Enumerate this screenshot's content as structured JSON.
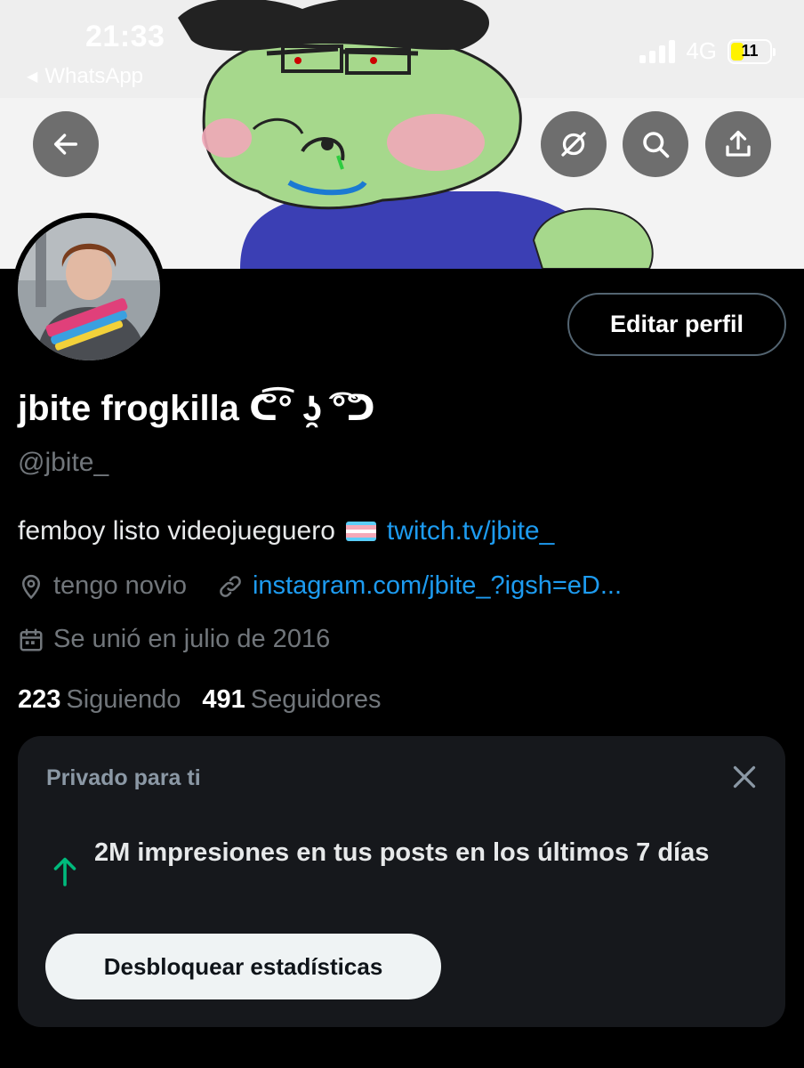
{
  "status_bar": {
    "time": "21:33",
    "back_app": "WhatsApp",
    "network": "4G",
    "battery": "11"
  },
  "header_buttons": {
    "back": "back-arrow-icon",
    "hide": "eye-slash-icon",
    "search": "search-icon",
    "share": "share-icon"
  },
  "profile": {
    "edit_button": "Editar perfil",
    "display_name": "jbite frogkilla ᕦ͡° ʖ̯ ͡°ᕤ",
    "handle": "@jbite_",
    "bio_text": "femboy listo videojueguero",
    "bio_link": "twitch.tv/jbite_",
    "location": "tengo novio",
    "website": "instagram.com/jbite_?igsh=eD...",
    "joined": "Se unió en julio de 2016",
    "following_count": "223",
    "following_label": "Siguiendo",
    "followers_count": "491",
    "followers_label": "Seguidores"
  },
  "private_card": {
    "title": "Privado para ti",
    "message": "2M impresiones en tus posts en los últimos 7 días",
    "button": "Desbloquear estadísticas"
  },
  "colors": {
    "accent": "#1d9bf0",
    "muted": "#71767b",
    "growth": "#00ba7c",
    "card_bg": "#16181c"
  }
}
